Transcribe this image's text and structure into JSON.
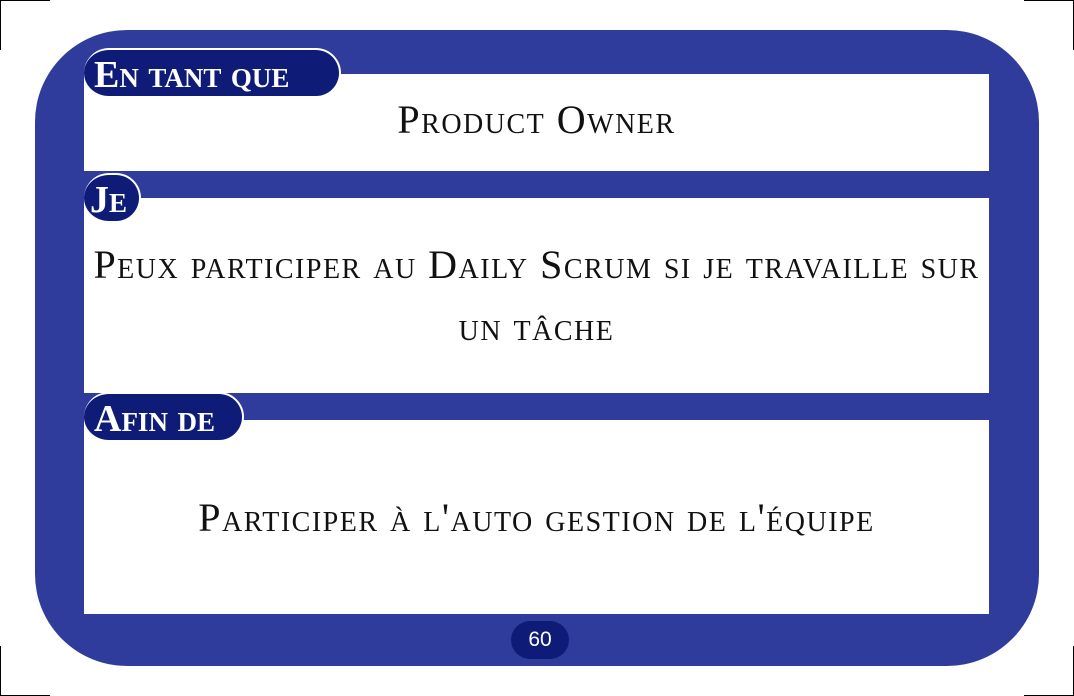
{
  "card": {
    "as_label": "En tant que",
    "as_value": "Product Owner",
    "i_label": "Je",
    "i_value": "Peux participer au Daily Scrum si je travaille sur un tâche",
    "so_label": "Afin de",
    "so_value": "Participer à l'auto gestion de l'équipe",
    "page_number": "60"
  },
  "colors": {
    "card_border": "#2f3c9c",
    "label_background": "#0e1c78",
    "panel_background": "#ffffff"
  }
}
